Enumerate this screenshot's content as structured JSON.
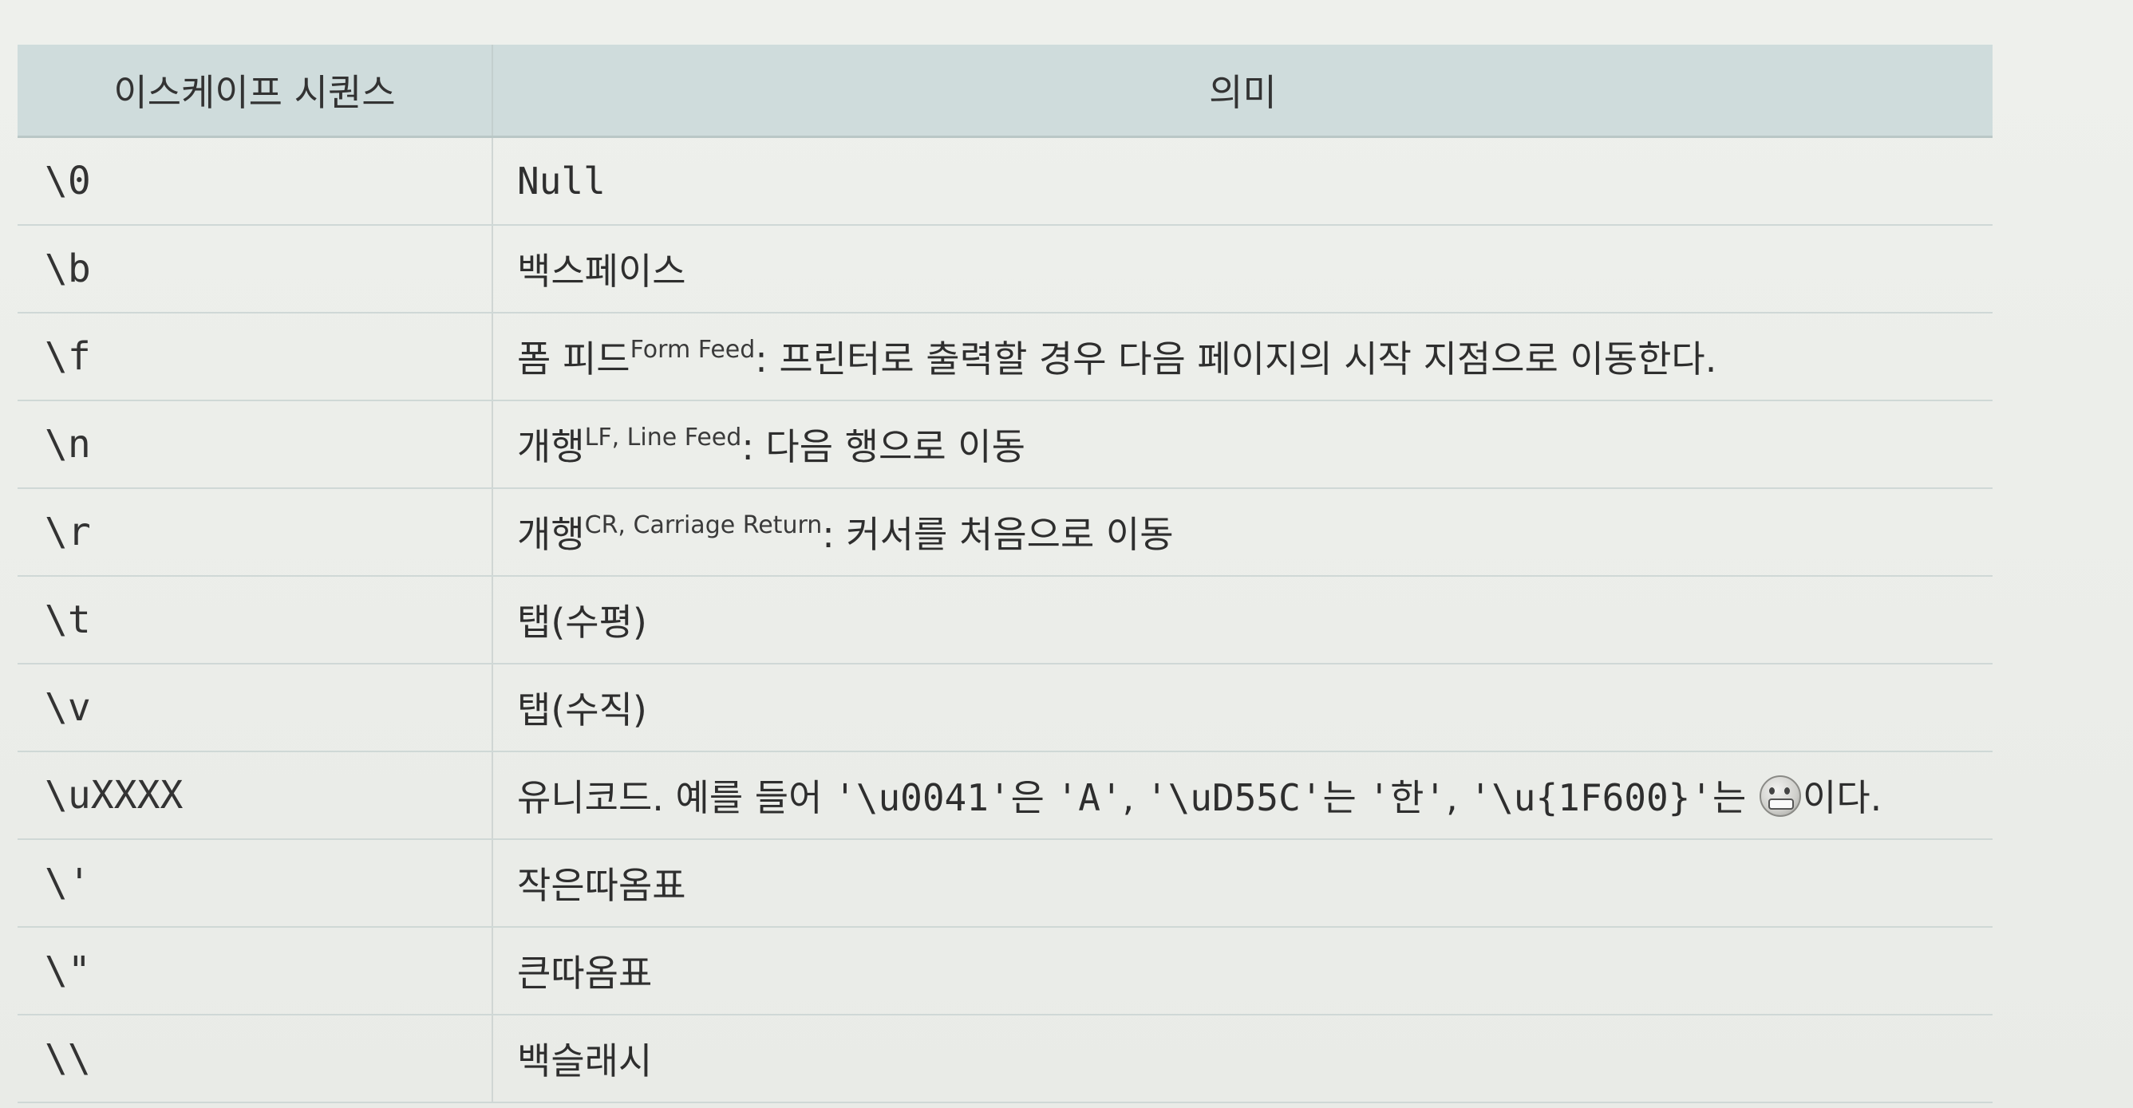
{
  "header": {
    "col_sequence": "이스케이프 시퀀스",
    "col_meaning": "의미"
  },
  "rows": [
    {
      "seq": "\\0",
      "meaning": "Null"
    },
    {
      "seq": "\\b",
      "meaning": "백스페이스"
    },
    {
      "seq": "\\f",
      "meaning_pre": "폼 피드",
      "meaning_note": "Form Feed",
      "meaning_post": ": 프린터로 출력할 경우 다음 페이지의 시작 지점으로 이동한다."
    },
    {
      "seq": "\\n",
      "meaning_pre": "개행",
      "meaning_note": "LF, Line Feed",
      "meaning_post": ": 다음 행으로 이동"
    },
    {
      "seq": "\\r",
      "meaning_pre": "개행",
      "meaning_note": "CR, Carriage Return",
      "meaning_post": ": 커서를 처음으로 이동"
    },
    {
      "seq": "\\t",
      "meaning": "탭(수평)"
    },
    {
      "seq": "\\v",
      "meaning": "탭(수직)"
    },
    {
      "seq": "\\uXXXX",
      "meaning_parts": [
        "유니코드. 예를 들어 ",
        "'\\u0041'",
        "은 ",
        "'A'",
        ", ",
        "'\\uD55C'",
        "는 ",
        "'한'",
        ", ",
        "'\\u{1F600}'",
        "는 ",
        "이다."
      ]
    },
    {
      "seq": "\\'",
      "meaning": "작은따옴표"
    },
    {
      "seq": "\\\"",
      "meaning": "큰따옴표"
    },
    {
      "seq": "\\\\",
      "meaning": "백슬래시"
    }
  ]
}
